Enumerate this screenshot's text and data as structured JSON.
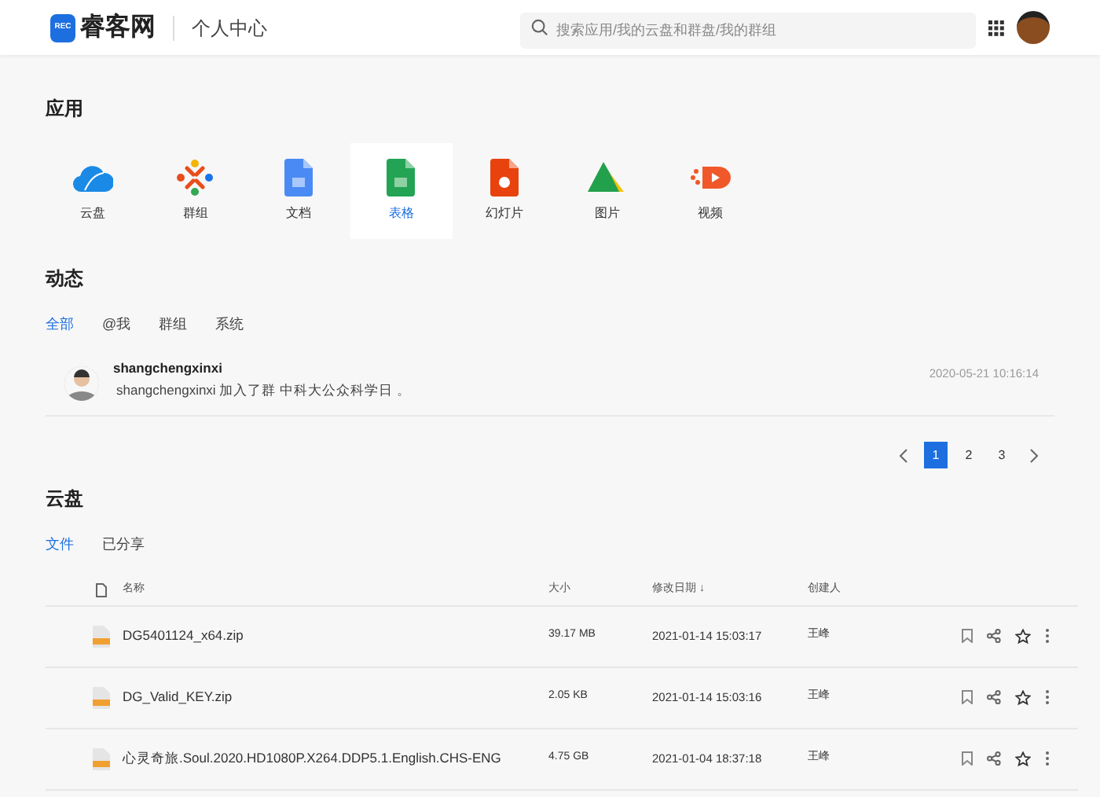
{
  "header": {
    "logo_badge": "REC",
    "logo_text": "睿客网",
    "section": "个人中心",
    "search": {
      "placeholder": "搜索应用/我的云盘和群盘/我的群组"
    }
  },
  "apps": {
    "title": "应用",
    "items": [
      {
        "kind": "cloud",
        "label": "云盘",
        "selected": false
      },
      {
        "kind": "group",
        "label": "群组",
        "selected": false
      },
      {
        "kind": "doc",
        "label": "文档",
        "selected": false
      },
      {
        "kind": "sheet",
        "label": "表格",
        "selected": true
      },
      {
        "kind": "slides",
        "label": "幻灯片",
        "selected": false
      },
      {
        "kind": "image",
        "label": "图片",
        "selected": false
      },
      {
        "kind": "video",
        "label": "视频",
        "selected": false
      }
    ]
  },
  "activity": {
    "title": "动态",
    "tabs": [
      {
        "label": "全部",
        "selected": true
      },
      {
        "label": "@我",
        "selected": false
      },
      {
        "label": "群组",
        "selected": false
      },
      {
        "label": "系统",
        "selected": false
      }
    ],
    "items": [
      {
        "user": "shangchengxinxi",
        "text": "shangchengxinxi 加入了群 中科大公众科学日 。",
        "time": "2020-05-21 10:16:14"
      }
    ],
    "pages": [
      {
        "label": "1",
        "selected": true
      },
      {
        "label": "2",
        "selected": false
      },
      {
        "label": "3",
        "selected": false
      }
    ]
  },
  "cloud": {
    "title": "云盘",
    "tabs": [
      {
        "label": "文件",
        "selected": true
      },
      {
        "label": "已分享",
        "selected": false
      }
    ],
    "columns": [
      "名称",
      "大小",
      "修改日期",
      "创建人"
    ],
    "sort_arrow": "↓",
    "rows": [
      {
        "name": "DG5401124_x64.zip",
        "size": "39.17 MB",
        "modified": "2021-01-14 15:03:17",
        "creator": "王峰"
      },
      {
        "name": "DG_Valid_KEY.zip",
        "size": "2.05 KB",
        "modified": "2021-01-14 15:03:16",
        "creator": "王峰"
      },
      {
        "name": "心灵奇旅.Soul.2020.HD1080P.X264.DDP5.1.English.CHS-ENG",
        "size": "4.75 GB",
        "modified": "2021-01-04 18:37:18",
        "creator": "王峰"
      }
    ]
  }
}
